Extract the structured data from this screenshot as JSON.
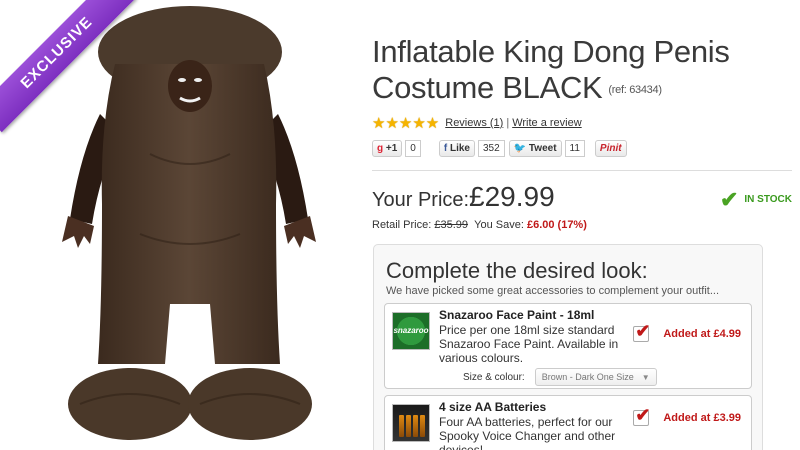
{
  "badge": {
    "label": "EXCLUSIVE"
  },
  "product": {
    "title": "Inflatable King Dong Penis Costume BLACK",
    "ref": "(ref: 63434)",
    "rating": {
      "stars": 5,
      "max_stars": 5,
      "reviews_label": "Reviews (1)",
      "separator": "|",
      "write_label": "Write a review"
    }
  },
  "social": {
    "gplus_label": "+1",
    "gplus_count": "0",
    "fb_label": "Like",
    "fb_count": "352",
    "tw_label": "Tweet",
    "tw_count": "11",
    "pin_label": "Pinit"
  },
  "pricing": {
    "your_price_label": "Your Price:",
    "price": "£29.99",
    "stock": "IN STOCK",
    "retail_label": "Retail Price:",
    "retail_price": "£35.99",
    "save_label": "You Save:",
    "save_value": "£6.00 (17%)"
  },
  "look": {
    "title": "Complete the desired look:",
    "subtitle": "We have picked some great accessories to complement your outfit...",
    "items": [
      {
        "name": "Snazaroo Face Paint - 18ml",
        "desc": "Price per one 18ml size standard Snazaroo Face Paint. Available in various colours.",
        "option_label": "Size & colour:",
        "option_value": "Brown - Dark One Size",
        "added": "Added at £4.99",
        "thumb_text": "snazaroo"
      },
      {
        "name": "4 size AA Batteries",
        "desc": "Four AA batteries, perfect for our Spooky Voice Changer and other devices!",
        "added": "Added at £3.99"
      }
    ]
  },
  "colors": {
    "accent_purple": "#8a3ccf",
    "price_red": "#c01919",
    "stock_green": "#3a9a1e",
    "star_gold": "#f5b400"
  }
}
